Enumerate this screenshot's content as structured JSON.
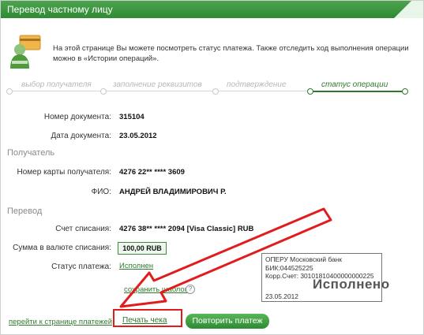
{
  "title": "Перевод частному лицу",
  "info_text": "На этой странице Вы можете посмотреть статус платежа. Также отследить ход выполнения операции можно в «Истории операций».",
  "steps": [
    {
      "label": "выбор получателя",
      "active": false
    },
    {
      "label": "заполнение реквизитов",
      "active": false
    },
    {
      "label": "подтверждение",
      "active": false
    },
    {
      "label": "статус операции",
      "active": true
    }
  ],
  "fields": {
    "doc_number_label": "Номер документа:",
    "doc_number": "315104",
    "doc_date_label": "Дата документа:",
    "doc_date": "23.05.2012",
    "recipient_section": "Получатель",
    "card_label": "Номер карты получателя:",
    "card": "4276 22** **** 3609",
    "fio_label": "ФИО:",
    "fio": "АНДРЕЙ ВЛАДИМИРОВИЧ Р.",
    "transfer_section": "Перевод",
    "account_label": "Счет списания:",
    "account": "4276 38** **** 2094  [Visa Classic]  RUB",
    "sum_label": "Сумма в валюте списания:",
    "sum": "100,00  RUB",
    "status_label": "Статус платежа:",
    "status": "Исполнен"
  },
  "stamp": {
    "line1": "ОПЕРУ Московский банк",
    "line2": "БИК:044525225",
    "line3": "Корр.Счет: 30101810400000000225",
    "status": "Исполнено",
    "date": "23.05.2012"
  },
  "links": {
    "save_template": "сохранить шаблон",
    "help": "?",
    "to_payments": "перейти к странице платежей",
    "print_receipt": "Печать чека"
  },
  "buttons": {
    "repeat": "Повторить платеж"
  },
  "colors": {
    "brand_green": "#2e8a33",
    "highlight_red": "#e11c1c"
  }
}
